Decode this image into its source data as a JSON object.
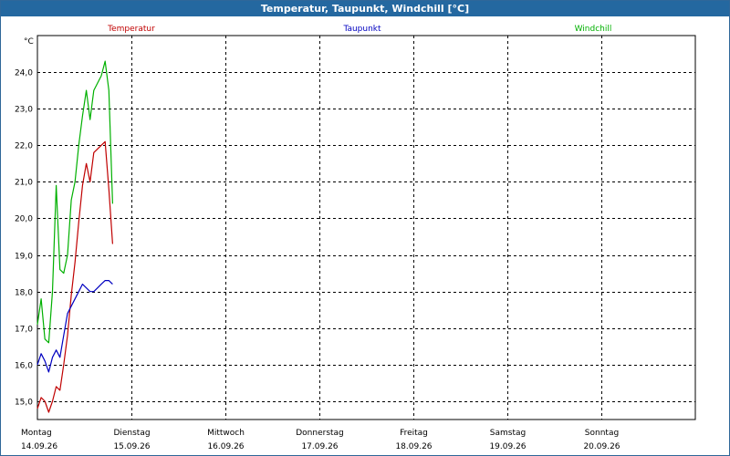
{
  "window": {
    "title": "Temperatur, Taupunkt, Windchill [°C]"
  },
  "chart_data": {
    "type": "line",
    "title": "Temperatur, Taupunkt, Windchill [°C]",
    "ylabel": "°C",
    "ylim": [
      14.5,
      25.0
    ],
    "yticks": [
      15.0,
      16.0,
      17.0,
      18.0,
      19.0,
      20.0,
      21.0,
      22.0,
      23.0,
      24.0
    ],
    "ytick_labels": [
      "15,0",
      "16,0",
      "17,0",
      "18,0",
      "19,0",
      "20,0",
      "21,0",
      "22,0",
      "23,0",
      "24,0"
    ],
    "xlim": [
      0,
      7
    ],
    "days": [
      {
        "weekday": "Montag",
        "date": "14.09.26"
      },
      {
        "weekday": "Dienstag",
        "date": "15.09.26"
      },
      {
        "weekday": "Mittwoch",
        "date": "16.09.26"
      },
      {
        "weekday": "Donnerstag",
        "date": "17.09.26"
      },
      {
        "weekday": "Freitag",
        "date": "18.09.26"
      },
      {
        "weekday": "Samstag",
        "date": "19.09.26"
      },
      {
        "weekday": "Sonntag",
        "date": "20.09.26"
      }
    ],
    "grid": true,
    "legend_position": "top",
    "series": [
      {
        "name": "Temperatur",
        "color": "#c00000",
        "x": [
          0.0,
          0.04,
          0.08,
          0.12,
          0.16,
          0.2,
          0.24,
          0.28,
          0.32,
          0.36,
          0.4,
          0.44,
          0.48,
          0.52,
          0.56,
          0.6,
          0.64,
          0.68,
          0.72,
          0.76,
          0.8
        ],
        "y": [
          14.8,
          15.1,
          15.0,
          14.7,
          15.0,
          15.4,
          15.3,
          16.0,
          16.8,
          17.9,
          18.8,
          19.9,
          20.9,
          21.5,
          21.0,
          21.8,
          21.9,
          22.0,
          22.1,
          20.8,
          19.3
        ]
      },
      {
        "name": "Taupunkt",
        "color": "#0000c0",
        "x": [
          0.0,
          0.04,
          0.08,
          0.12,
          0.16,
          0.2,
          0.24,
          0.28,
          0.32,
          0.36,
          0.4,
          0.44,
          0.48,
          0.52,
          0.56,
          0.6,
          0.64,
          0.68,
          0.72,
          0.76,
          0.8
        ],
        "y": [
          16.0,
          16.3,
          16.1,
          15.8,
          16.2,
          16.4,
          16.2,
          16.8,
          17.4,
          17.6,
          17.8,
          18.0,
          18.2,
          18.1,
          18.0,
          18.0,
          18.1,
          18.2,
          18.3,
          18.3,
          18.2
        ]
      },
      {
        "name": "Windchill",
        "color": "#00b000",
        "x": [
          0.0,
          0.04,
          0.08,
          0.12,
          0.16,
          0.2,
          0.24,
          0.28,
          0.32,
          0.36,
          0.4,
          0.44,
          0.48,
          0.52,
          0.56,
          0.6,
          0.64,
          0.68,
          0.72,
          0.76,
          0.8
        ],
        "y": [
          17.1,
          17.8,
          16.7,
          16.6,
          18.0,
          20.9,
          18.6,
          18.5,
          19.0,
          20.5,
          21.0,
          22.0,
          22.8,
          23.5,
          22.7,
          23.5,
          23.7,
          23.9,
          24.3,
          23.5,
          20.4
        ]
      }
    ]
  }
}
